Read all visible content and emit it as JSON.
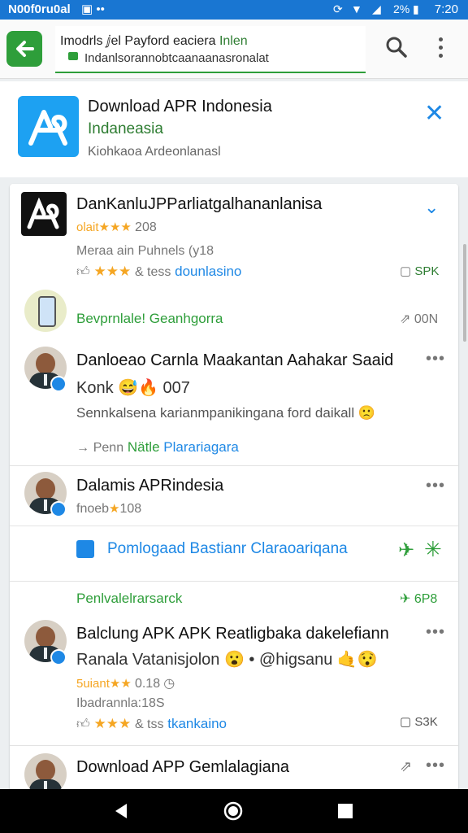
{
  "status": {
    "carrier": "N00f0ru0al",
    "time": "7:20",
    "battery": "2%",
    "colors": {
      "bar": "#1976d2"
    }
  },
  "browser": {
    "url_line1_a": "Imodrls ⅉel Payford eaciera",
    "url_line1_b": "Inlen",
    "url_line2": "Indanlsorannobtcaanaanasronalat",
    "icons": [
      "arrow-back-icon",
      "lock-icon",
      "search-icon",
      "more-vert-icon"
    ]
  },
  "banner": {
    "title": "Download APR Indonesia",
    "subtitle": "Indaneasia",
    "description": "Kiohkaoa Ardeonlanasl",
    "accent": "#1da1f2"
  },
  "items": [
    {
      "title": "DanKanluJPParliatgalhananlanisa",
      "rating_text": "olait",
      "rating_stars": "★★★",
      "rating_count": "208",
      "meta": "Meraa ain  Puhnels (y18",
      "stars_line": "★★★",
      "stars_tail": "& tess",
      "link": "dounlasino",
      "badge": "SPK"
    },
    {
      "title": "Bevprnlale! Geanhgorra",
      "count": "00N"
    },
    {
      "title": "Danloeao Carnla Maakantan Aahakar Saaid",
      "subtitle": "Konk 😅🔥 007",
      "body": "Sennkalsena karianmpanikingana ford daikall 🙁",
      "action": "Penn",
      "action_green": "Nätle",
      "action_link": "Plarariagara"
    },
    {
      "title": "Dalamis APRindesia",
      "rating_text": "fnoeb",
      "rating_stars": "★",
      "rating_count": "108"
    },
    {
      "title": "Pomlogaad Bastianr Claraoariqana"
    },
    {
      "title": "Penlvalelrarsarck",
      "badge": "6P8"
    },
    {
      "title": "Balclung APK APK Reatligbaka dakelefiann",
      "subtitle": "Ranala Vatanisjolon 😮 • @higsanu 🤙😯",
      "rating_text": "5uiant",
      "rating_stars": "★★",
      "rating_count": "0.18",
      "meta": "Ibadrannla:18S",
      "stars_line": "★★★",
      "stars_tail": "& tss",
      "link": "tkankaino",
      "badge": "S3K"
    },
    {
      "title": "Download APP Gemlalagiana"
    }
  ]
}
